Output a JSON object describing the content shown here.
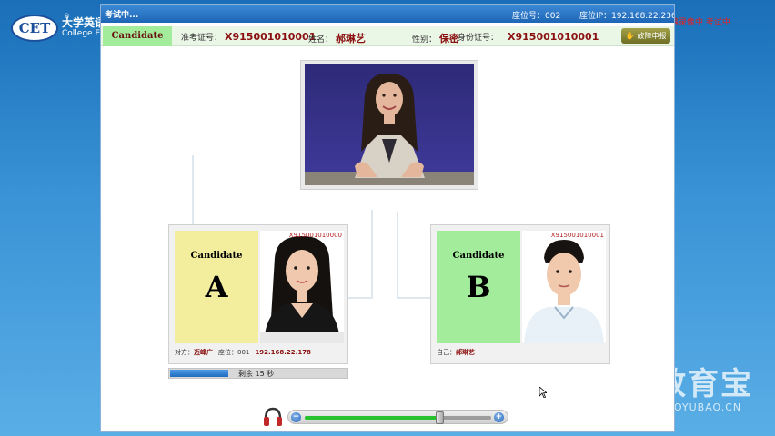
{
  "colors": {
    "desktop_blue": "#3a93d6",
    "titlebar_blue": "#1d65b5",
    "candidate_a_yellow": "#f2ee9e",
    "candidate_b_green": "#a3ec9c",
    "value_red": "#8b1010",
    "volume_green": "#27c22e"
  },
  "desktop": {
    "logo": "CET",
    "logo_mark": "®",
    "logo_cn": "大学英语",
    "logo_en": "College E",
    "red_note": "屏幕录像中 考试中",
    "watermark_cn": "教育宝",
    "watermark_en": "JIAOYUBAO.CN"
  },
  "window": {
    "title": "考试中...",
    "seat_no": "座位号：002",
    "seat_ip": "座位IP：192.168.22.236"
  },
  "info": {
    "exam_id_label": "准考证号：",
    "exam_id": "X915001010001",
    "name_label": "姓名：",
    "name": "郝琳艺",
    "gender_label": "性别：",
    "gender": "保密",
    "idcard_label": "身份证号：",
    "idcard": "X915001010001",
    "help_button": "故障申报",
    "help_icon": "hand-icon"
  },
  "self_badge": {
    "label": "Candidate",
    "letter": "B"
  },
  "candidates": {
    "a": {
      "label": "Candidate",
      "letter": "A",
      "photo_id": "X915001010000",
      "footer_label": "对方：",
      "footer_name": "迈峰广",
      "footer_seat": "座位：001",
      "footer_ip": "192.168.22.178"
    },
    "b": {
      "label": "Candidate",
      "letter": "B",
      "photo_id": "X915001010001",
      "footer_label": "自己：",
      "footer_name": "郝琳艺"
    }
  },
  "timer": {
    "text": "剩余 15 秒",
    "progress": 0.33
  },
  "volume": {
    "minus": "−",
    "plus": "+",
    "level": 0.72,
    "icon": "headphone-icon"
  }
}
